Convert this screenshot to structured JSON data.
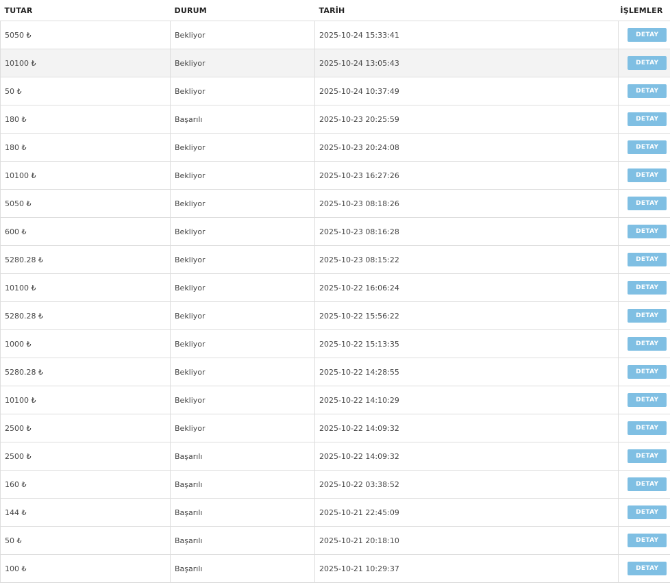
{
  "table": {
    "headers": {
      "tutar": "TUTAR",
      "durum": "DURUM",
      "tarih": "TARİH",
      "islemler": "İŞLEMLER"
    },
    "action_label": "DETAY",
    "rows": [
      {
        "tutar": "5050 ₺",
        "durum": "Bekliyor",
        "tarih": "2025-10-24 15:33:41"
      },
      {
        "tutar": "10100 ₺",
        "durum": "Bekliyor",
        "tarih": "2025-10-24 13:05:43"
      },
      {
        "tutar": "50 ₺",
        "durum": "Bekliyor",
        "tarih": "2025-10-24 10:37:49"
      },
      {
        "tutar": "180 ₺",
        "durum": "Başarılı",
        "tarih": "2025-10-23 20:25:59"
      },
      {
        "tutar": "180 ₺",
        "durum": "Bekliyor",
        "tarih": "2025-10-23 20:24:08"
      },
      {
        "tutar": "10100 ₺",
        "durum": "Bekliyor",
        "tarih": "2025-10-23 16:27:26"
      },
      {
        "tutar": "5050 ₺",
        "durum": "Bekliyor",
        "tarih": "2025-10-23 08:18:26"
      },
      {
        "tutar": "600 ₺",
        "durum": "Bekliyor",
        "tarih": "2025-10-23 08:16:28"
      },
      {
        "tutar": "5280.28 ₺",
        "durum": "Bekliyor",
        "tarih": "2025-10-23 08:15:22"
      },
      {
        "tutar": "10100 ₺",
        "durum": "Bekliyor",
        "tarih": "2025-10-22 16:06:24"
      },
      {
        "tutar": "5280.28 ₺",
        "durum": "Bekliyor",
        "tarih": "2025-10-22 15:56:22"
      },
      {
        "tutar": "1000 ₺",
        "durum": "Bekliyor",
        "tarih": "2025-10-22 15:13:35"
      },
      {
        "tutar": "5280.28 ₺",
        "durum": "Bekliyor",
        "tarih": "2025-10-22 14:28:55"
      },
      {
        "tutar": "10100 ₺",
        "durum": "Bekliyor",
        "tarih": "2025-10-22 14:10:29"
      },
      {
        "tutar": "2500 ₺",
        "durum": "Bekliyor",
        "tarih": "2025-10-22 14:09:32"
      },
      {
        "tutar": "2500 ₺",
        "durum": "Başarılı",
        "tarih": "2025-10-22 14:09:32"
      },
      {
        "tutar": "160 ₺",
        "durum": "Başarılı",
        "tarih": "2025-10-22 03:38:52"
      },
      {
        "tutar": "144 ₺",
        "durum": "Başarılı",
        "tarih": "2025-10-21 22:45:09"
      },
      {
        "tutar": "50 ₺",
        "durum": "Başarılı",
        "tarih": "2025-10-21 20:18:10"
      },
      {
        "tutar": "100 ₺",
        "durum": "Başarılı",
        "tarih": "2025-10-21 10:29:37"
      }
    ]
  },
  "colors": {
    "button_bg": "#7fbfe3",
    "row_alt_bg": "#f3f3f3",
    "border": "#dddddd"
  }
}
